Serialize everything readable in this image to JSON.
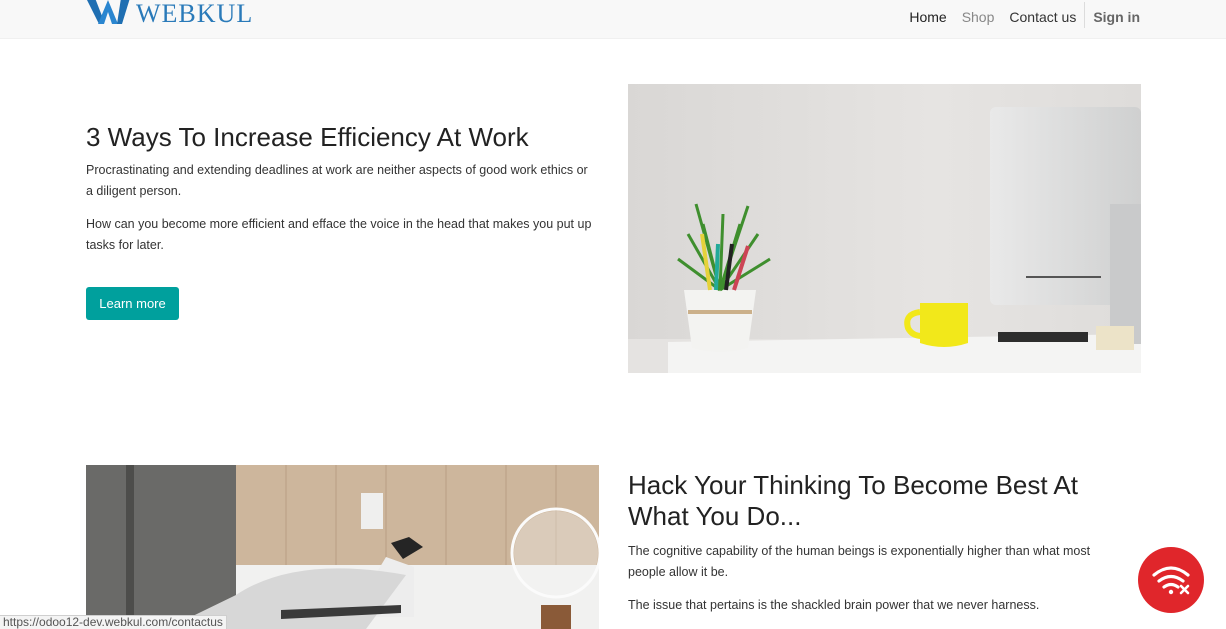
{
  "header": {
    "brand": "WEBKUL",
    "nav": {
      "home": "Home",
      "shop": "Shop",
      "contact": "Contact us",
      "signin": "Sign in"
    }
  },
  "section1": {
    "title": "3 Ways To Increase Efficiency At Work",
    "para1": "Procrastinating and extending deadlines at work are neither aspects of good work ethics or a diligent person.",
    "para2": "How can you become more efficient and efface the voice in the head that makes you put up tasks for later.",
    "button": "Learn more"
  },
  "section2": {
    "title": "Hack Your Thinking To Become Best At What You Do...",
    "para1": "The cognitive capability of the human beings is exponentially higher than what most people allow it be.",
    "para2": "The issue that pertains is the shackled brain power that we never harness."
  },
  "status_bar": "https://odoo12-dev.webkul.com/contactus",
  "icons": {
    "logo": "webkul-logo-icon",
    "fab": "wifi-off-icon"
  },
  "colors": {
    "accent": "#00a09d",
    "brand": "#2a7ab9",
    "fab": "#e0262b"
  }
}
